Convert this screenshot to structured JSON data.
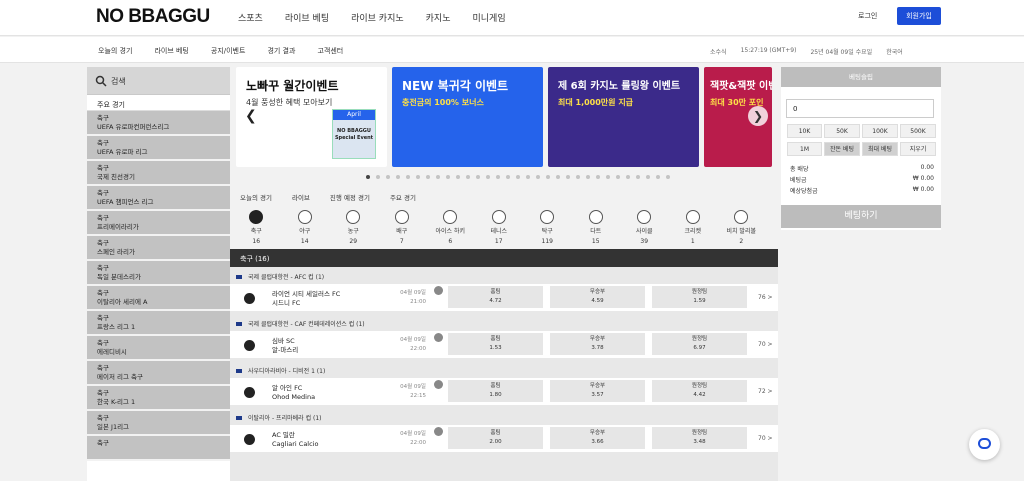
{
  "header": {
    "logo": "NO BBAGGU",
    "nav": [
      "스포츠",
      "라이브 베팅",
      "라이브 카지노",
      "카지노",
      "미니게임"
    ],
    "login": "로그인",
    "join": "회원가입"
  },
  "subnav": {
    "items": [
      "오늘의 경기",
      "라이브 베팅",
      "공지/이벤트",
      "경기 결과",
      "고객센터"
    ],
    "right": [
      "소수식",
      "15:27:19 (GMT+9)",
      "25년 04월 09일 수요일",
      "한국어"
    ]
  },
  "sidebar": {
    "search": "검색",
    "head": "주요 경기",
    "items": [
      {
        "sport": "축구",
        "league": "UEFA 유로파컨퍼런스리그"
      },
      {
        "sport": "축구",
        "league": "UEFA 유로파 리그"
      },
      {
        "sport": "축구",
        "league": "국제 친선경기"
      },
      {
        "sport": "축구",
        "league": "UEFA 챔피언스 리그"
      },
      {
        "sport": "축구",
        "league": "프리메이라리가"
      },
      {
        "sport": "축구",
        "league": "스페인 라리가"
      },
      {
        "sport": "축구",
        "league": "독일 분데스리가"
      },
      {
        "sport": "축구",
        "league": "이탈리아 세리에 A"
      },
      {
        "sport": "축구",
        "league": "프랑스 리그 1"
      },
      {
        "sport": "축구",
        "league": "에레디비시"
      },
      {
        "sport": "축구",
        "league": "메이저 리그 축구"
      },
      {
        "sport": "축구",
        "league": "한국 K-리그 1"
      },
      {
        "sport": "축구",
        "league": "일본 J1리그"
      },
      {
        "sport": "축구",
        "league": ""
      }
    ]
  },
  "banners": [
    {
      "title": "노빠꾸 월간이벤트",
      "sub": "4월 풍성한 혜택 모아보기",
      "tag": "April",
      "extra": "NO BBAGGU Special Event"
    },
    {
      "title": "NEW 복귀각 이벤트",
      "sub": "충전금의 100% 보너스"
    },
    {
      "title": "제 6회 카지노 룰링왕 이벤트",
      "sub": "최대 1,000만원 지급"
    },
    {
      "title": "잭팟&잭팟 이벤트",
      "sub": "최대 30만 포인"
    }
  ],
  "tabs": [
    "오늘의 경기",
    "라이브",
    "진행 예정 경기",
    "주요 경기"
  ],
  "sports": [
    {
      "name": "축구",
      "count": "16"
    },
    {
      "name": "야구",
      "count": "14"
    },
    {
      "name": "농구",
      "count": "29"
    },
    {
      "name": "배구",
      "count": "7"
    },
    {
      "name": "아이스 하키",
      "count": "6"
    },
    {
      "name": "테니스",
      "count": "17"
    },
    {
      "name": "탁구",
      "count": "119"
    },
    {
      "name": "다트",
      "count": "15"
    },
    {
      "name": "사이클",
      "count": "39"
    },
    {
      "name": "크리켓",
      "count": "1"
    },
    {
      "name": "비치 발리볼",
      "count": "2"
    }
  ],
  "panel_title": "축구 (16)",
  "matches": [
    {
      "league": "국제 클럽대항전 - AFC 컵 (1)",
      "home": "라이언 시티 세일러스 FC",
      "away": "시드니 FC",
      "date": "04월 09일",
      "time": "21:00",
      "o1": "4.72",
      "ox": "4.59",
      "o2": "1.59",
      "more": "76 >"
    },
    {
      "league": "국제 클럽대항전 - CAF 컨페데레이션스 컵 (1)",
      "home": "심바 SC",
      "away": "알-마스리",
      "date": "04월 09일",
      "time": "22:00",
      "o1": "1.53",
      "ox": "3.78",
      "o2": "6.97",
      "more": "70 >"
    },
    {
      "league": "사우디아라비아 - 디비전 1 (1)",
      "home": "알 아인 FC",
      "away": "Ohod Medina",
      "date": "04월 09일",
      "time": "22:15",
      "o1": "1.80",
      "ox": "3.57",
      "o2": "4.42",
      "more": "72 >"
    },
    {
      "league": "이탈리아 - 프리마베라 컵 (1)",
      "home": "AC 밀란",
      "away": "Cagliari Calcio",
      "date": "04월 09일",
      "time": "22:00",
      "o1": "2.00",
      "ox": "3.66",
      "o2": "3.48",
      "more": "70 >"
    }
  ],
  "labels": {
    "home": "홈팀",
    "draw": "무승부",
    "away": "원정팀"
  },
  "betslip": {
    "title": "베팅슬립",
    "amount": "0",
    "chips": [
      "10K",
      "50K",
      "100K",
      "500K",
      "1M",
      "잔돈 베팅",
      "최대 베팅",
      "지우기"
    ],
    "rows": [
      {
        "label": "총 배당",
        "value": "0.00"
      },
      {
        "label": "베팅금",
        "value": "₩ 0.00"
      },
      {
        "label": "예상당첨금",
        "value": "₩ 0.00"
      }
    ],
    "button": "베팅하기"
  }
}
